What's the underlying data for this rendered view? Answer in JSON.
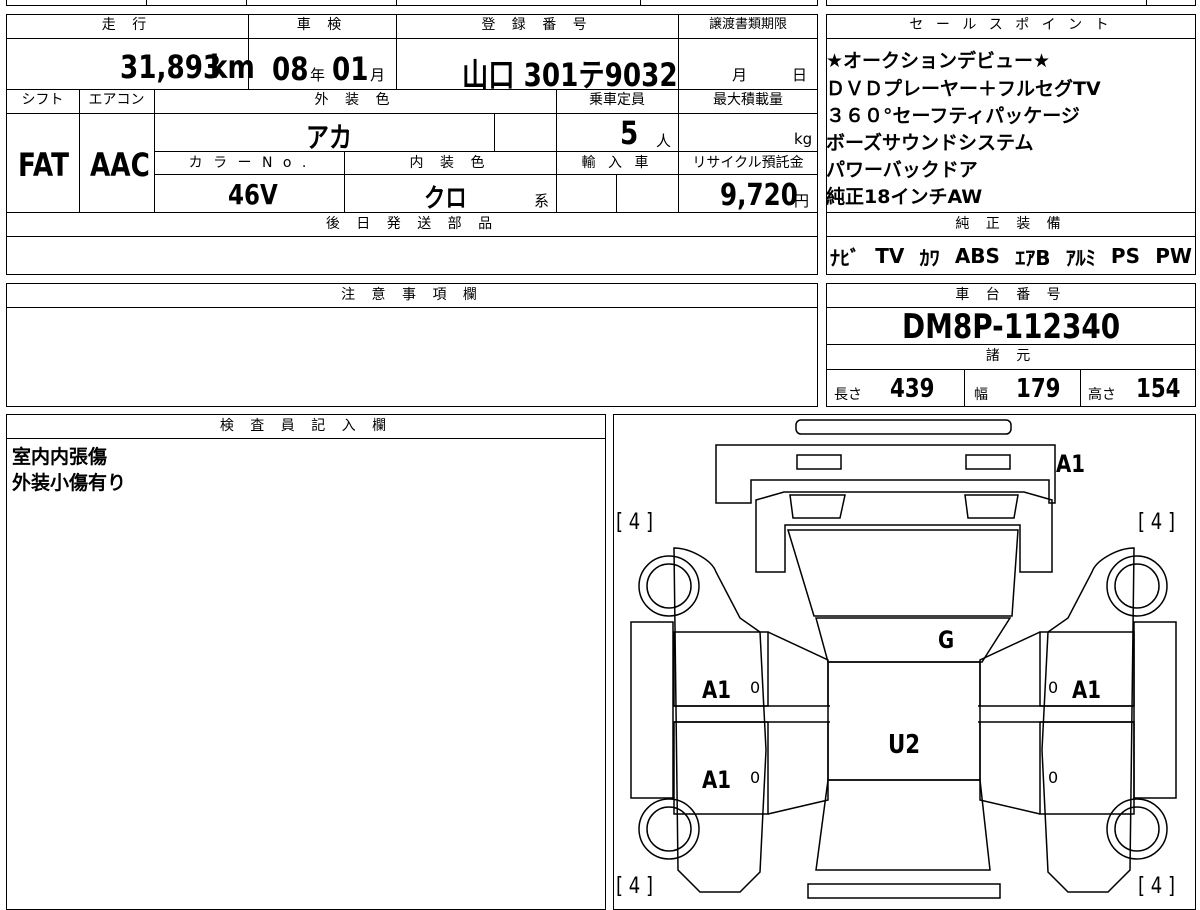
{
  "top_block": {
    "mileage_header": "走 行",
    "mileage_value": "31,893",
    "mileage_unit": "km",
    "inspection_header": "車 検",
    "inspection_year": "08",
    "inspection_year_unit": "年",
    "inspection_month": "01",
    "inspection_month_unit": "月",
    "registration_header": "登 録 番 号",
    "registration_value": "山口 301テ9032",
    "transfer_deadline_header": "譲渡書類期限",
    "transfer_month_unit": "月",
    "transfer_day_unit": "日",
    "shift_header": "シフト",
    "shift_value": "FAT",
    "aircon_header": "エアコン",
    "aircon_value": "AAC",
    "exterior_color_header": "外 装 色",
    "exterior_color_value": "アカ",
    "capacity_header": "乗車定員",
    "capacity_value": "5",
    "capacity_unit": "人",
    "max_load_header": "最大積載量",
    "max_load_unit": "kg",
    "color_no_header": "カ ラ ー N o .",
    "color_no_value": "46V",
    "interior_color_header": "内 装 色",
    "interior_color_value": "クロ",
    "interior_color_suffix": "系",
    "import_header": "輸 入 車",
    "recycle_header": "リサイクル預託金",
    "recycle_value": "9,720",
    "recycle_unit": "円",
    "later_parts_header": "後 日 発 送 部 品"
  },
  "sales_points": {
    "header": "セ ー ル ス ポ イ ン ト",
    "items": [
      "★オークションデビュー★",
      "ＤＶＤプレーヤー＋フルセグTV",
      "３６０°セーフティパッケージ",
      "ボーズサウンドシステム",
      "パワーバックドア",
      "純正18インチAW"
    ]
  },
  "equipment": {
    "header": "純 正 装 備",
    "items": [
      "ﾅﾋﾞ",
      "TV",
      "ｶﾜ",
      "ABS",
      "ｴｱB",
      "ｱﾙﾐ",
      "PS",
      "PW"
    ]
  },
  "notes": {
    "header": "注 意 事 項 欄"
  },
  "chassis": {
    "header": "車 台 番 号",
    "value": "DM8P-112340"
  },
  "specs": {
    "header": "諸 元",
    "length_label": "長さ",
    "length_value": "439",
    "width_label": "幅",
    "width_value": "179",
    "height_label": "高さ",
    "height_value": "154"
  },
  "inspector": {
    "header": "検 査 員 記 入 欄",
    "lines": [
      "室内内張傷",
      "外装小傷有り"
    ]
  },
  "diagram": {
    "tire_front_left": "[ 4 ]",
    "tire_front_right": "[ 4 ]",
    "tire_rear_left": "[ 4 ]",
    "tire_rear_right": "[ 4 ]",
    "mark_rear_bumper": "A1",
    "mark_windshield": "G",
    "mark_roof": "U2",
    "mark_left_front_door": "A1",
    "mark_left_front_door_score": "0",
    "mark_left_rear_door": "A1",
    "mark_left_rear_door_score": "0",
    "mark_right_front_door": "A1",
    "mark_right_front_door_score": "0",
    "mark_right_rear_door_score": "0"
  }
}
